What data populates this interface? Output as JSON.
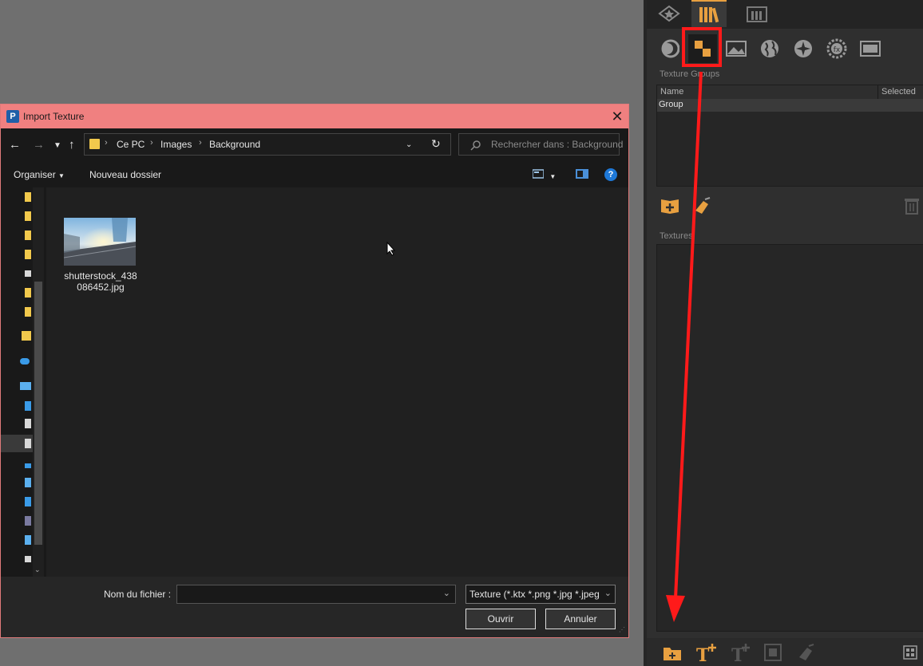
{
  "right_panel": {
    "top_tabs": [
      "favorites-tab",
      "library-tab",
      "folder-tab"
    ],
    "icon_row": [
      "material-icon",
      "texture-icon",
      "image-icon",
      "environment-icon",
      "sun-icon",
      "effects-icon",
      "backplate-icon"
    ],
    "texture_groups_label": "Texture Groups",
    "groups_table": {
      "columns": [
        "Name",
        "Selected"
      ],
      "rows": [
        {
          "name": "Group",
          "selected": ""
        }
      ]
    },
    "textures_label": "Textures"
  },
  "dialog": {
    "title": "Import Texture",
    "app_icon_letter": "P",
    "breadcrumb": [
      "Ce PC",
      "Images",
      "Background"
    ],
    "search_placeholder": "Rechercher dans : Background",
    "organize_label": "Organiser",
    "new_folder_label": "Nouveau dossier",
    "files": [
      {
        "name": "shutterstock_438086452.jpg"
      }
    ],
    "filename_label": "Nom du fichier :",
    "filename_value": "",
    "filter_value": "Texture (*.ktx *.png *.jpg *.jpeg",
    "open_label": "Ouvrir",
    "cancel_label": "Annuler"
  },
  "colors": {
    "annotation": "#ff1a1a",
    "accent": "#e8a040",
    "titlebar": "#f08080"
  }
}
